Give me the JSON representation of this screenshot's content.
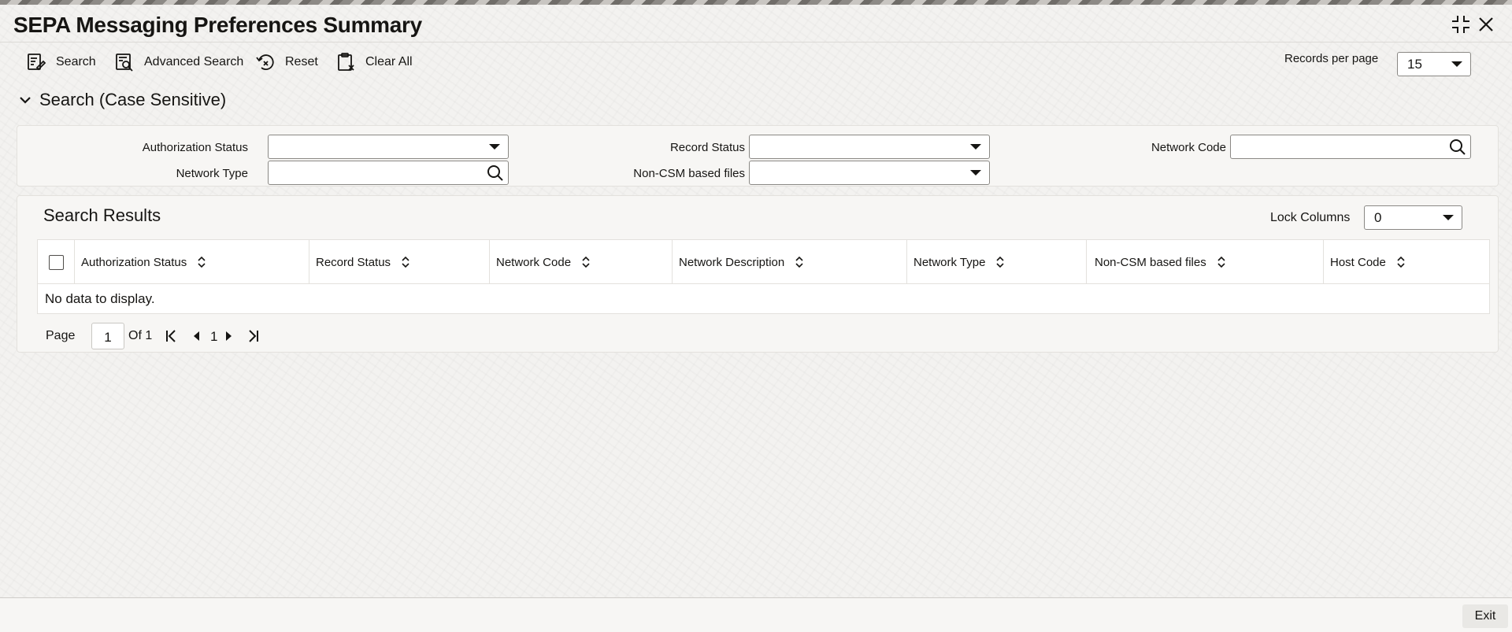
{
  "window": {
    "title": "SEPA Messaging Preferences Summary",
    "maximize_icon": "collapse-arrows-icon",
    "close_icon": "close-icon"
  },
  "toolbar": {
    "search_label": "Search",
    "advanced_search_label": "Advanced Search",
    "reset_label": "Reset",
    "clear_all_label": "Clear All",
    "records_per_page_label": "Records per page",
    "records_per_page_value": "15"
  },
  "search_section": {
    "title": "Search (Case Sensitive)",
    "fields": {
      "authorization_status": {
        "label": "Authorization Status",
        "value": ""
      },
      "record_status": {
        "label": "Record Status",
        "value": ""
      },
      "network_code": {
        "label": "Network Code",
        "value": ""
      },
      "network_type": {
        "label": "Network Type",
        "value": ""
      },
      "non_csm_based_files": {
        "label": "Non-CSM based files",
        "value": ""
      }
    }
  },
  "results": {
    "title": "Search Results",
    "lock_columns_label": "Lock Columns",
    "lock_columns_value": "0",
    "columns": [
      "Authorization Status",
      "Record Status",
      "Network Code",
      "Network Description",
      "Network Type",
      "Non-CSM based files",
      "Host Code"
    ],
    "rows": [],
    "empty_message": "No data to display."
  },
  "pagination": {
    "page_label": "Page",
    "current_page": "1",
    "of_label": "Of 1",
    "page_number": "1"
  },
  "footer": {
    "exit_label": "Exit"
  },
  "colors": {
    "text": "#161513",
    "background": "#f3f2f0",
    "panel": "#f7f6f4",
    "border": "#8a8884"
  }
}
